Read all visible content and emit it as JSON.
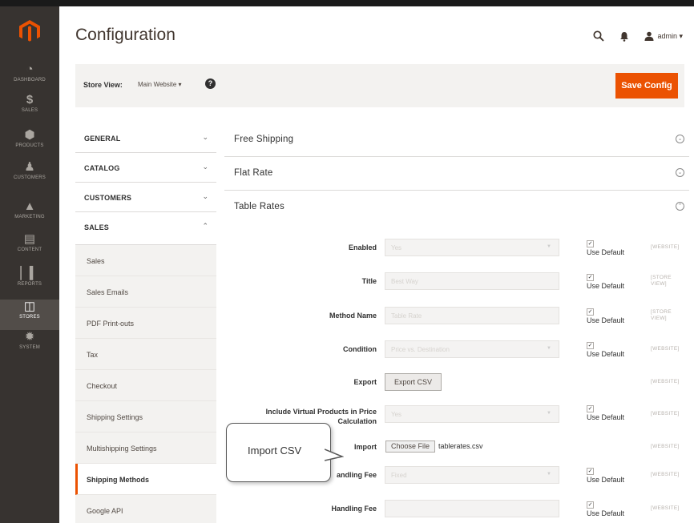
{
  "colors": {
    "accent": "#eb5202",
    "sidebar_bg": "#373330",
    "sidebar_active": "#524d49",
    "page_bar_bg": "#f3f2f0"
  },
  "nav": [
    {
      "label": "DASHBOARD",
      "icon": "dashboard-icon"
    },
    {
      "label": "SALES",
      "icon": "dollar-icon"
    },
    {
      "label": "PRODUCTS",
      "icon": "cube-icon"
    },
    {
      "label": "CUSTOMERS",
      "icon": "person-icon"
    },
    {
      "label": "MARKETING",
      "icon": "megaphone-icon"
    },
    {
      "label": "CONTENT",
      "icon": "content-icon"
    },
    {
      "label": "REPORTS",
      "icon": "bar-chart-icon"
    },
    {
      "label": "STORES",
      "icon": "store-icon",
      "active": true
    },
    {
      "label": "SYSTEM",
      "icon": "gear-icon"
    }
  ],
  "header": {
    "title": "Configuration",
    "admin": "admin ▾"
  },
  "page_bar": {
    "store_view_label": "Store View:",
    "store_view_value": "Main Website ▾",
    "help": "?",
    "save_label": "Save Config"
  },
  "tabs": [
    {
      "label": "GENERAL",
      "chevron": "⌄"
    },
    {
      "label": "CATALOG",
      "chevron": "⌄"
    },
    {
      "label": "CUSTOMERS",
      "chevron": "⌄"
    },
    {
      "label": "SALES",
      "chevron": "⌃"
    }
  ],
  "subtabs": [
    "Sales",
    "Sales Emails",
    "PDF Print-outs",
    "Tax",
    "Checkout",
    "Shipping Settings",
    "Multishipping Settings",
    "Shipping Methods",
    "Google API"
  ],
  "active_subtab": "Shipping Methods",
  "sections": [
    {
      "title": "Free Shipping",
      "toggle": "⌄"
    },
    {
      "title": "Flat Rate",
      "toggle": "⌄"
    },
    {
      "title": "Table Rates",
      "toggle": "⌃"
    }
  ],
  "use_default_label": "Use Default",
  "check": "✓",
  "fields": {
    "enabled": {
      "label": "Enabled",
      "value": "Yes",
      "scope": "[WEBSITE]"
    },
    "title": {
      "label": "Title",
      "value": "Best Way",
      "scope": "[STORE VIEW]"
    },
    "method_name": {
      "label": "Method Name",
      "value": "Table Rate",
      "scope": "[STORE VIEW]"
    },
    "condition": {
      "label": "Condition",
      "value": "Price vs. Destination",
      "scope": "[WEBSITE]"
    },
    "export": {
      "label": "Export",
      "button": "Export CSV",
      "scope": "[WEBSITE]"
    },
    "include_virtual": {
      "label": "Include Virtual Products in Price Calculation",
      "value": "Yes",
      "scope": "[WEBSITE]"
    },
    "import": {
      "label": "Import",
      "button": "Choose File",
      "filename": "tablerates.csv",
      "scope": "[WEBSITE]"
    },
    "calc_handling": {
      "label": "andling Fee",
      "value": "Fixed",
      "scope": "[WEBSITE]"
    },
    "handling_fee": {
      "label": "Handling Fee",
      "value": "",
      "scope": "[WEBSITE]"
    }
  },
  "callout": {
    "text": "Import CSV"
  }
}
